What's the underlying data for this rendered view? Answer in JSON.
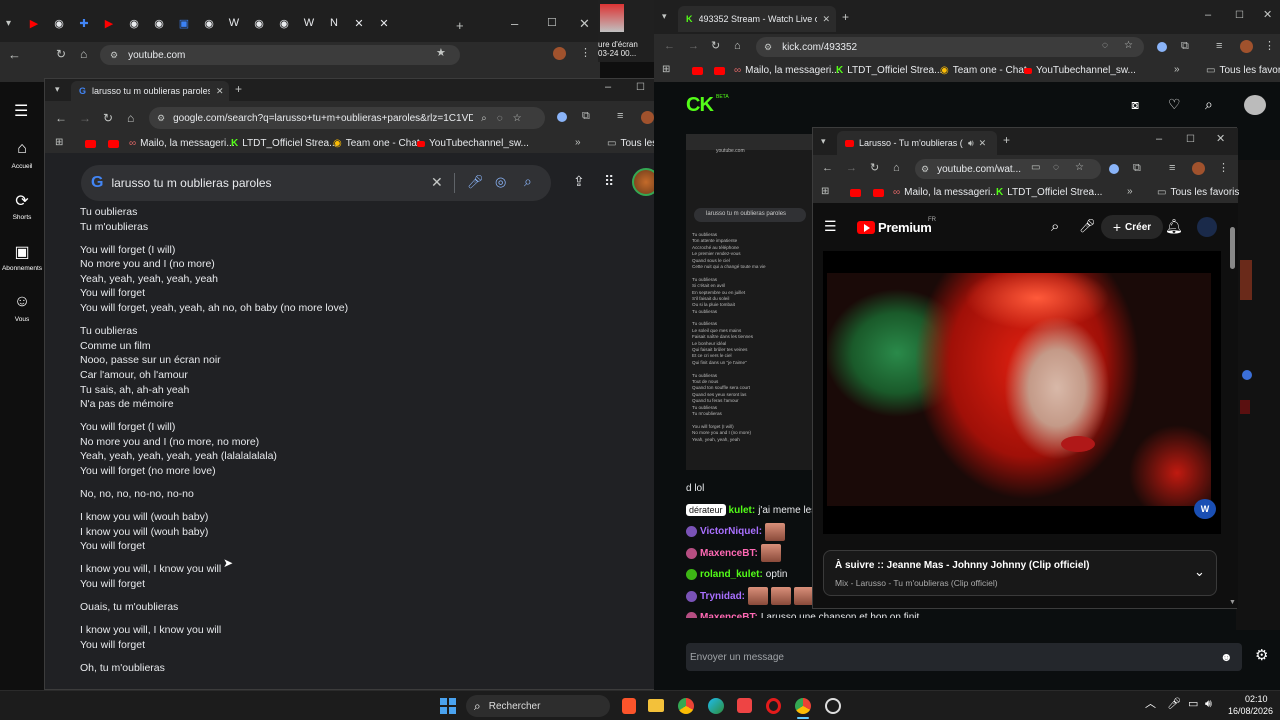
{
  "back_window": {
    "url": "youtube.com",
    "tab_icons": [
      "youtube-tab-icon",
      "chrome-tab-icon",
      "apps-tab-icon",
      "youtube-tab-icon",
      "chrome-tab-icon",
      "chrome-tab-icon",
      "camera-tab-icon",
      "chrome-tab-icon",
      "w-tab-icon",
      "chrome-tab-icon",
      "chrome-tab-icon",
      "w-tab-icon",
      "notion-tab-icon",
      "x-tab-icon",
      "x-tab-icon"
    ],
    "clipped_text_1": "ure d'écran",
    "clipped_text_2": "03-24 00..."
  },
  "youtube_sidebar": {
    "items": [
      {
        "label": "Accueil",
        "icon": "home-icon"
      },
      {
        "label": "Shorts",
        "icon": "shorts-icon"
      },
      {
        "label": "Abonnements",
        "icon": "subscriptions-icon"
      },
      {
        "label": "Vous",
        "icon": "user-icon"
      }
    ]
  },
  "google_window": {
    "tab_title": "larusso tu m oublieras paroles",
    "url": "google.com/search?q=larusso+tu+m+oublieras+paroles&rlz=1C1VDK...",
    "bookmarks": [
      "Mailo, la messageri...",
      "LTDT_Officiel Strea...",
      "Team one - Chat",
      "YouTubechannel_sw..."
    ],
    "all_bookmarks": "Tous les favoris",
    "search_query": "larusso tu m oublieras paroles",
    "lyrics": [
      [
        "Tu oublieras",
        "Tu m'oublieras"
      ],
      [
        "You will forget (I will)",
        "No more you and I (no more)",
        "Yeah, yeah, yeah, yeah, yeah",
        "You will forget",
        "You will forget, yeah, yeah, ah no, oh baby (no more love)"
      ],
      [
        "Tu oublieras",
        "Comme un film",
        "Nooo, passe sur un écran noir",
        "Car l'amour, oh l'amour",
        "Tu sais, ah, ah-ah yeah",
        "N'a pas de mémoire"
      ],
      [
        "You will forget (I will)",
        "No more you and I (no more, no more)",
        "Yeah, yeah, yeah, yeah, yeah (lalalalalala)",
        "You will forget (no more love)"
      ],
      [
        "No, no, no, no-no, no-no"
      ],
      [
        "I know you will (wouh baby)",
        "I know you will (wouh baby)",
        "You will forget"
      ],
      [
        "I know you will, I know you will",
        "You will forget"
      ],
      [
        "Ouais, tu m'oublieras"
      ],
      [
        "I know you will, I know you will",
        "You will forget"
      ],
      [
        "Oh, tu m'oublieras"
      ]
    ]
  },
  "kick_window": {
    "tab_title": "493352 Stream - Watch Live on",
    "url": "kick.com/493352",
    "bookmarks": [
      "Mailo, la messageri...",
      "LTDT_Officiel Strea...",
      "Team one - Chat",
      "YouTubechannel_sw..."
    ],
    "all_bookmarks": "Tous les favoris",
    "logo": "CK",
    "logo_badge": "BETA",
    "mini_tab": "larusso tu m oublieras paroles",
    "mini_url": "youtube.com",
    "mini_lyrics": [
      "Tu oublieras",
      "Ton attente impatiente",
      "Accroché au téléphone",
      "Le premier rendez-vous",
      "Quand sous le ciel",
      "Cette nuit qui a changé toute ma vie",
      "",
      "Tu oublieras",
      "Si c'était en avril",
      "En septembre ou en juillet",
      "S'il faisait du soleil",
      "Ou si la pluie tombait",
      "Tu oublieras",
      "",
      "Tu oublieras",
      "Le soleil que mes mains",
      "Faisait naître dans les tiennes",
      "Le bonheur idéal",
      "Qui faisait brûler tes veines",
      "Et ce cri vers le ciel",
      "Qui finit dans un \"je t'aime\"",
      "",
      "Tu oublieras",
      "Tout de nous",
      "Quand ton souffle sera court",
      "Quand ses yeux seront las",
      "Quand tu feras l'amour",
      "Tu oublieras",
      "Tu m'oublieras",
      "",
      "You will forget (I will)",
      "No more you and I (no more)",
      "Yeah, yeah, yeah, yeah"
    ],
    "chat": [
      {
        "user": "",
        "text": "d lol",
        "color": "#e8eaed"
      },
      {
        "user": "kulet",
        "text": "j'ai meme les",
        "color": "#53fc18",
        "badge": "dérateur"
      },
      {
        "user": "VictorNiquel",
        "text": "",
        "color": "#a970ff",
        "emotes": 1
      },
      {
        "user": "MaxenceBT",
        "text": "",
        "color": "#ff69b4",
        "emotes": 1
      },
      {
        "user": "roland_kulet",
        "text": "optin",
        "color": "#53fc18"
      },
      {
        "user": "Trynidad",
        "text": "",
        "color": "#a970ff",
        "emotes": 3
      },
      {
        "user": "MaxenceBT",
        "text": "Larusso une chanson et hop on finit",
        "color": "#ff69b4"
      }
    ],
    "chat_placeholder": "Envoyer un message"
  },
  "youtube_window": {
    "tab_title": "Larusso - Tu m'oublieras (C",
    "url": "youtube.com/wat...",
    "bookmarks": [
      "Mailo, la messageri...",
      "LTDT_Officiel Strea..."
    ],
    "all_bookmarks": "Tous les favoris",
    "logo": "Premium",
    "region": "FR",
    "create_label": "Créer",
    "up_next_title": "À suivre :: Jeanne Mas - Johnny Johnny (Clip officiel)",
    "up_next_sub": "Mix - Larusso - Tu m'oublieras (Clip officiel)"
  },
  "taskbar": {
    "search_label": "Rechercher",
    "time": "02:10",
    "date": "16/08/2026"
  },
  "colors": {
    "kick_green": "#53fc18",
    "youtube_red": "#ff0000",
    "google_blue": "#4285f4"
  }
}
